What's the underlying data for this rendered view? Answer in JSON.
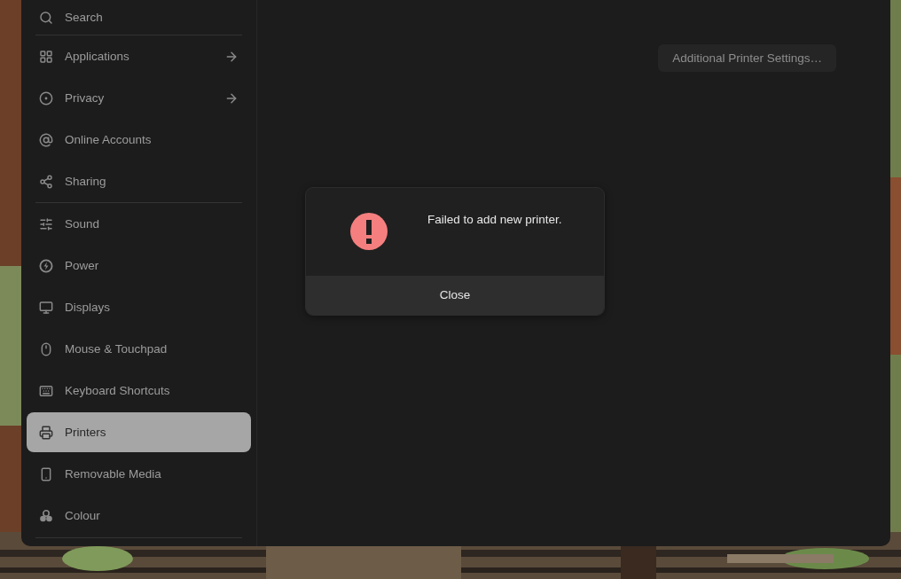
{
  "sidebar": {
    "search": {
      "label": "Search"
    },
    "groups": [
      [
        {
          "label": "Applications",
          "arrow": true,
          "selected": false
        },
        {
          "label": "Privacy",
          "arrow": true,
          "selected": false
        },
        {
          "label": "Online Accounts",
          "arrow": false,
          "selected": false
        },
        {
          "label": "Sharing",
          "arrow": false,
          "selected": false
        }
      ],
      [
        {
          "label": "Sound",
          "arrow": false,
          "selected": false
        },
        {
          "label": "Power",
          "arrow": false,
          "selected": false
        },
        {
          "label": "Displays",
          "arrow": false,
          "selected": false
        },
        {
          "label": "Mouse & Touchpad",
          "arrow": false,
          "selected": false
        },
        {
          "label": "Keyboard Shortcuts",
          "arrow": false,
          "selected": false
        },
        {
          "label": "Printers",
          "arrow": false,
          "selected": true
        },
        {
          "label": "Removable Media",
          "arrow": false,
          "selected": false
        },
        {
          "label": "Colour",
          "arrow": false,
          "selected": false
        }
      ]
    ]
  },
  "content": {
    "settings_button": "Additional Printer Settings…"
  },
  "dialog": {
    "message": "Failed to add new printer.",
    "button": "Close"
  }
}
